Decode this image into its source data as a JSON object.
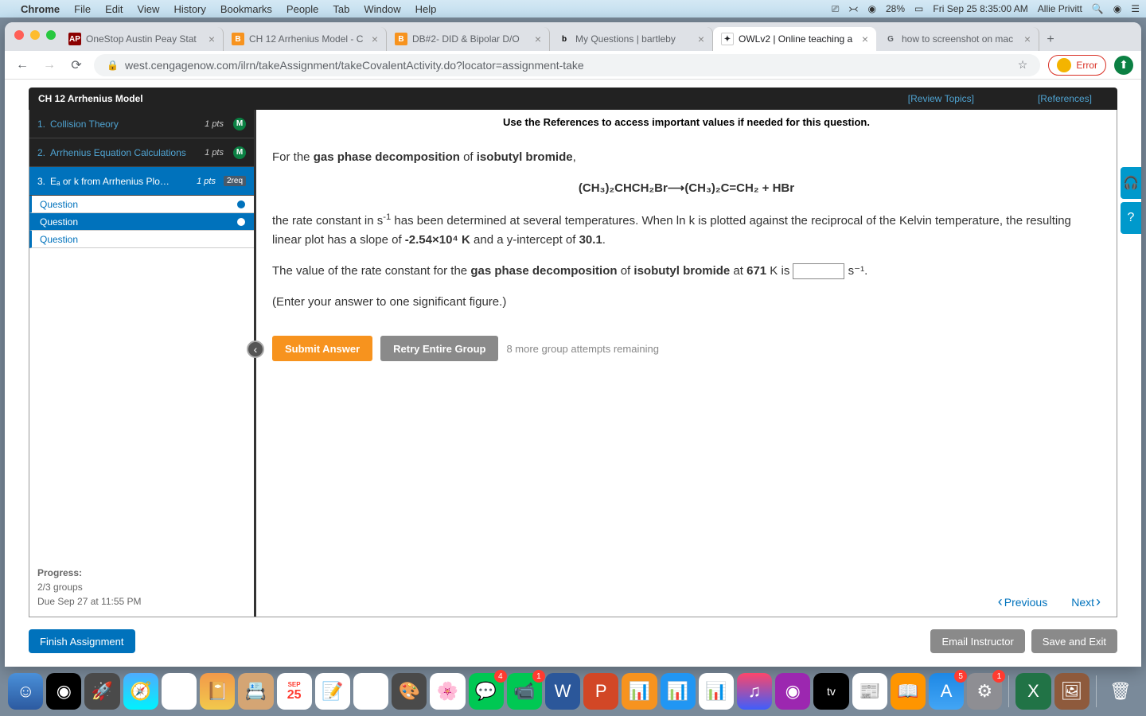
{
  "menubar": {
    "app": "Chrome",
    "items": [
      "File",
      "Edit",
      "View",
      "History",
      "Bookmarks",
      "People",
      "Tab",
      "Window",
      "Help"
    ],
    "battery": "28%",
    "datetime": "Fri Sep 25  8:35:00 AM",
    "user": "Allie Privitt"
  },
  "tabs": [
    {
      "title": "OneStop Austin Peay Stat",
      "fav": "ap"
    },
    {
      "title": "CH 12 Arrhenius Model - C",
      "fav": "b"
    },
    {
      "title": "DB#2- DID & Bipolar D/O",
      "fav": "b"
    },
    {
      "title": "My Questions | bartleby",
      "fav": "bart"
    },
    {
      "title": "OWLv2 | Online teaching a",
      "fav": "owl",
      "active": true
    },
    {
      "title": "how to screenshot on mac",
      "fav": "g"
    }
  ],
  "url": "west.cengagenow.com/ilrn/takeAssignment/takeCovalentActivity.do?locator=assignment-take",
  "error_label": "Error",
  "assignment": {
    "title": "CH 12 Arrhenius Model",
    "review": "[Review Topics]",
    "references": "[References]"
  },
  "sidebar": {
    "items": [
      {
        "num": "1.",
        "title": "Collision Theory",
        "pts": "1 pts",
        "badge": "M"
      },
      {
        "num": "2.",
        "title": "Arrhenius Equation Calculations",
        "pts": "1 pts",
        "badge": "M"
      },
      {
        "num": "3.",
        "title": "Eₐ or k from Arrhenius Plot Infor…",
        "pts": "1 pts",
        "req": "2req"
      }
    ],
    "subq": [
      "Question",
      "Question",
      "Question"
    ]
  },
  "instruct": "Use the References to access important values if needed for this question.",
  "question": {
    "p1a": "For the ",
    "p1b": "gas phase decomposition",
    "p1c": " of ",
    "p1d": "isobutyl bromide",
    "p1e": ",",
    "eq": "(CH₃)₂CHCH₂Br⟶(CH₃)₂C=CH₂ + HBr",
    "p2a": "the rate constant in s",
    "p2b": " has been determined at several temperatures. When ln k is plotted against the reciprocal of the Kelvin temperature, the resulting linear plot has a slope of ",
    "p2c": "-2.54×10⁴ K",
    "p2d": " and a y-intercept of ",
    "p2e": "30.1",
    "p2f": ".",
    "p3a": "The value of the rate constant for the ",
    "p3b": "gas phase decomposition",
    "p3c": " of ",
    "p3d": "isobutyl bromide",
    "p3e": " at ",
    "p3f": "671",
    "p3g": " K is ",
    "p3h": " s⁻¹.",
    "hint": "(Enter your answer to one significant figure.)"
  },
  "buttons": {
    "submit": "Submit Answer",
    "retry": "Retry Entire Group",
    "attempts": "8 more group attempts remaining",
    "prev": "Previous",
    "next": "Next",
    "finish": "Finish Assignment",
    "email": "Email Instructor",
    "save": "Save and Exit"
  },
  "progress": {
    "label": "Progress:",
    "groups": "2/3 groups",
    "due": "Due Sep 27 at 11:55 PM"
  },
  "dock_tv": "tv",
  "dock_cal": "25"
}
